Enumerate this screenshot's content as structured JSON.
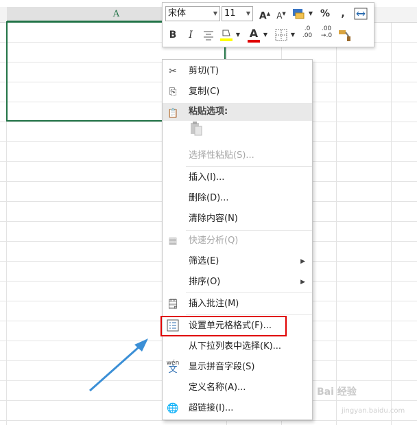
{
  "sheet": {
    "column_header": "A"
  },
  "mini_toolbar": {
    "font_name": "宋体",
    "font_size": "11",
    "grow_font": "A",
    "shrink_font": "A",
    "percent": "%",
    "comma": ",",
    "bold": "B",
    "italic": "I",
    "font_color": "A",
    "dec_increase_a": ".0",
    "dec_increase_b": ".00",
    "dec_decrease_a": ".00",
    "dec_decrease_b": "→.0"
  },
  "context_menu": {
    "cut": "剪切(T)",
    "copy": "复制(C)",
    "paste_options": "粘贴选项:",
    "paste_special": "选择性粘贴(S)...",
    "insert": "插入(I)...",
    "delete": "删除(D)...",
    "clear_contents": "清除内容(N)",
    "quick_analysis": "快速分析(Q)",
    "filter": "筛选(E)",
    "sort": "排序(O)",
    "insert_comment": "插入批注(M)",
    "format_cells": "设置单元格格式(F)...",
    "pick_from_list": "从下拉列表中选择(K)...",
    "phonetic": "显示拼音字段(S)",
    "phonetic_icon_text": "wén",
    "define_name": "定义名称(A)...",
    "hyperlink": "超链接(I)..."
  },
  "watermark": {
    "brand": "Bai 经验",
    "url": "jingyan.baidu.com"
  },
  "colors": {
    "accent_green": "#217346",
    "highlight_red": "#e00000",
    "arrow_blue": "#3b8fd6"
  }
}
